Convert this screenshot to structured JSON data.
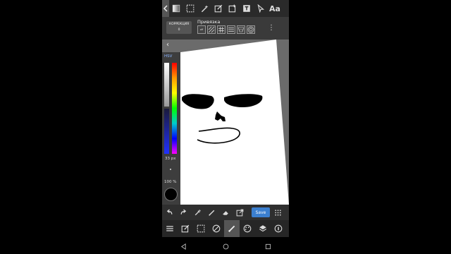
{
  "toolbar_top": {
    "icons": [
      "collapse-icon",
      "gradient-icon",
      "selection-icon",
      "magic-wand-icon",
      "edit-selection-icon",
      "add-layer-icon",
      "fill-icon",
      "cursor-icon"
    ],
    "text_tool_label": "Aa"
  },
  "subbar": {
    "correction_label": "КОРРЕКЦИЯ",
    "correction_value": "0",
    "snap_label": "Привязка",
    "snap_off_label": "off"
  },
  "color_panel": {
    "mode_label": "HSV",
    "brush_size": "33 px",
    "opacity": "100 %",
    "current_color": "#000000"
  },
  "bottom_toolbar": {
    "save_label": "Save",
    "accent_color": "#3b7fcf"
  },
  "main_toolbar": {
    "active_tool": "brush"
  }
}
